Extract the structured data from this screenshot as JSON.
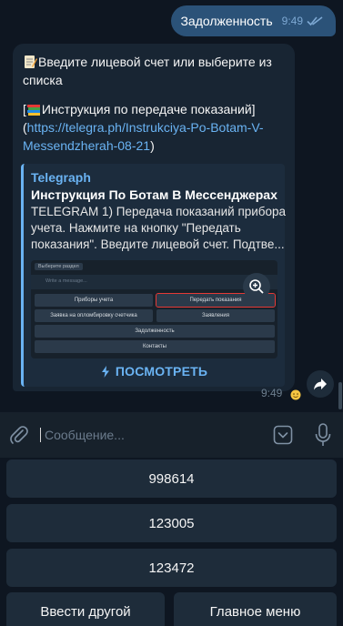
{
  "outgoing": {
    "text": "Задолженность",
    "time": "9:49"
  },
  "incoming": {
    "line1": "Введите лицевой счет или выберите из",
    "line2": "списка",
    "instruction_open": "[",
    "instruction_label": "Инструкция по передаче показаний]",
    "link_open": "(",
    "link_part1": "https://telegra.ph/Instrukciya-Po-Botam-V-",
    "link_part2": "Messendzherah-08-21",
    "link_close": ")",
    "time": "9:49"
  },
  "preview": {
    "site": "Telegraph",
    "title": "Инструкция По Ботам В Мессенджерах",
    "desc_line1": "TELEGRAM 1) Передача показаний прибора",
    "desc_line2": "учета. Нажмите на кнопку \"Передать",
    "desc_line3": "показания\". Введите лицевой счет. Подтве...",
    "view_label": "ПОСМОТРЕТЬ",
    "image": {
      "header": "Выберите раздел",
      "input_placeholder": "Write a message...",
      "buttons": [
        "Приборы учета",
        "Передать показания",
        "Заявка на опломбировку счетчика",
        "Заявления",
        "Задолженность",
        "Контакты"
      ]
    }
  },
  "composer": {
    "placeholder": "Сообщение..."
  },
  "keyboard": {
    "buttons": [
      "998614",
      "123005",
      "123472",
      "Ввести другой",
      "Главное меню"
    ]
  },
  "colors": {
    "accent": "#6ab3f3",
    "outgoing_bubble": "#2b5278",
    "incoming_bubble": "#182533",
    "background": "#0e1621"
  }
}
